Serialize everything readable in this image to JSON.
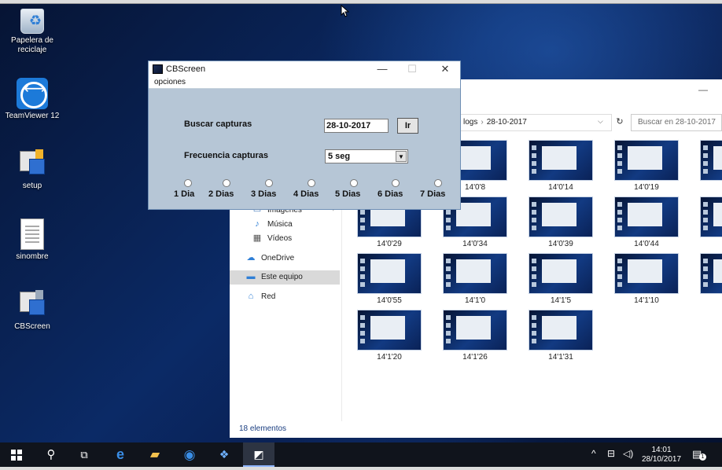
{
  "desktop": {
    "icons": [
      {
        "label": "Papelera de reciclaje"
      },
      {
        "label": "TeamViewer 12"
      },
      {
        "label": "setup"
      },
      {
        "label": "sinombre"
      },
      {
        "label": "CBScreen"
      }
    ]
  },
  "explorer": {
    "breadcrumb": [
      "logs",
      "28-10-2017"
    ],
    "search_placeholder": "Buscar en 28-10-2017",
    "nav": [
      "Imágenes",
      "Música",
      "Vídeos",
      "OneDrive",
      "Este equipo",
      "Red"
    ],
    "thumbnails": [
      "14'0'8",
      "14'0'14",
      "14'0'19",
      "14'0'29",
      "14'0'34",
      "14'0'39",
      "14'0'44",
      "14'0'55",
      "14'1'0",
      "14'1'5",
      "14'1'10",
      "14'1'20",
      "14'1'26",
      "14'1'31"
    ],
    "status": "18 elementos"
  },
  "cbscreen": {
    "title": "CBScreen",
    "menu": "opciones",
    "buscar_label": "Buscar capturas",
    "date_value": "28-10-2017",
    "go_button": "Ir",
    "frecuencia_label": "Frecuencia capturas",
    "frecuencia_value": "5 seg",
    "radios": [
      "1 Dia",
      "2 Dias",
      "3 Dias",
      "4 Dias",
      "5 Dias",
      "6 Dias",
      "7 Dias"
    ]
  },
  "taskbar": {
    "time": "14:01",
    "date": "28/10/2017",
    "notifications": "1"
  },
  "colors": {
    "dialog_bg": "#b6c6d6",
    "taskbar_bg": "#10141c",
    "accent": "#1c7ad9"
  }
}
